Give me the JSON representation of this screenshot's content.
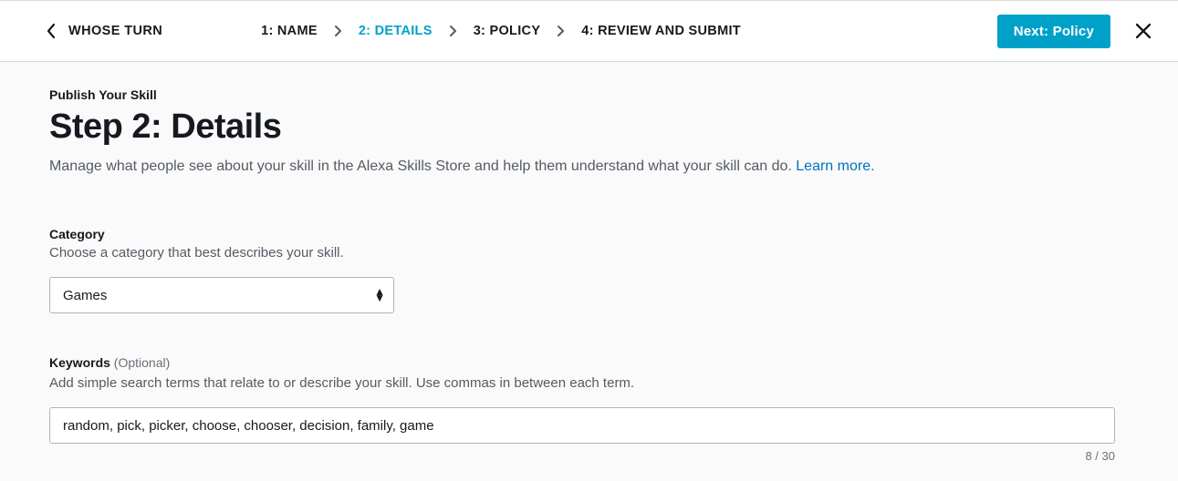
{
  "header": {
    "back_label": "WHOSE TURN",
    "steps": [
      {
        "label": "1: NAME",
        "active": false
      },
      {
        "label": "2: DETAILS",
        "active": true
      },
      {
        "label": "3: POLICY",
        "active": false
      },
      {
        "label": "4: REVIEW AND SUBMIT",
        "active": false
      }
    ],
    "next_button": "Next: Policy"
  },
  "page": {
    "eyebrow": "Publish Your Skill",
    "title": "Step 2: Details",
    "subtitle_pre": "Manage what people see about your skill in the Alexa Skills Store and help them understand what your skill can do. ",
    "subtitle_link": "Learn more.",
    "category": {
      "label": "Category",
      "hint": "Choose a category that best describes your skill.",
      "value": "Games"
    },
    "keywords": {
      "label": "Keywords",
      "optional": " (Optional)",
      "hint": "Add simple search terms that relate to or describe your skill. Use commas in between each term.",
      "value": "random, pick, picker, choose, chooser, decision, family, game",
      "counter": "8 / 30"
    }
  }
}
